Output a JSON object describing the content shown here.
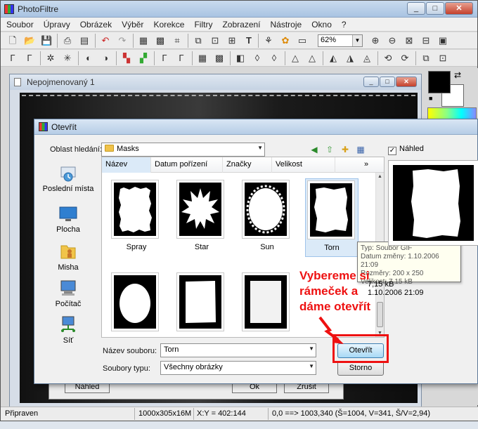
{
  "app": {
    "title": "PhotoFiltre",
    "menu": [
      "Soubor",
      "Úpravy",
      "Obrázek",
      "Výběr",
      "Korekce",
      "Filtry",
      "Zobrazení",
      "Nástroje",
      "Okno",
      "?"
    ],
    "zoom": "62%",
    "window_buttons": {
      "minimize": "_",
      "maximize": "□",
      "close": "✕"
    }
  },
  "document": {
    "title": "Nepojmenovaný 1"
  },
  "background_dialog": {
    "buttons": [
      "Náhled",
      "Ok",
      "Zrušit"
    ]
  },
  "status": {
    "text": "Připraven",
    "size": "1000x305x16M",
    "coords": "X:Y = 402:144",
    "selection": "0,0 ==> 1003,340 (Š=1004, V=341, Š/V=2,94)"
  },
  "dialog": {
    "title": "Otevřít",
    "look_in_label": "Oblast hledání:",
    "look_in_value": "Masks",
    "places": [
      "Poslední místa",
      "Plocha",
      "Misha",
      "Počítač",
      "Síť"
    ],
    "columns": [
      "Název",
      "Datum pořízení",
      "Značky",
      "Velikost"
    ],
    "more_columns": "»",
    "files": [
      "Spray",
      "Star",
      "Sun",
      "Torn",
      "",
      "",
      ""
    ],
    "selected_file": "Torn",
    "tooltip": {
      "type": "Typ: Soubor GIF",
      "modified": "Datum změny: 1.10.2006 21:09",
      "dimensions": "Rozměry: 200 x 250",
      "size": "Velikost: 7,15 kB"
    },
    "preview_label": "Náhled",
    "preview_checked": "✓",
    "preview_info": [
      "7,15 kB",
      "1.10.2006 21:09"
    ],
    "filename_label": "Název souboru:",
    "filename_value": "Torn",
    "filetype_label": "Soubory typu:",
    "filetype_value": "Všechny obrázky",
    "open_button": "Otevřít",
    "cancel_button": "Storno"
  },
  "annotation": {
    "lines": [
      "Vybereme si",
      "rámeček a",
      "dáme otevřít"
    ],
    "color": "#e11111"
  },
  "colors": {
    "foreground": "#000000",
    "background": "#ffffff",
    "selection": "#dbeaf8"
  }
}
